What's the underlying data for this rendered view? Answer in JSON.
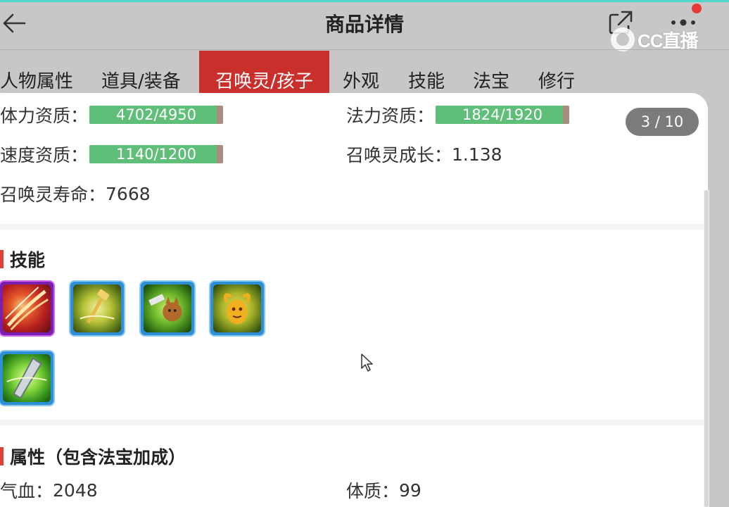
{
  "header": {
    "title": "商品详情"
  },
  "watermark": {
    "text": "CC直播"
  },
  "tabs": [
    {
      "label": "人物属性",
      "active": false
    },
    {
      "label": "道具/装备",
      "active": false
    },
    {
      "label": "召唤灵/孩子",
      "active": true
    },
    {
      "label": "外观",
      "active": false
    },
    {
      "label": "技能",
      "active": false
    },
    {
      "label": "法宝",
      "active": false
    },
    {
      "label": "修行",
      "active": false
    }
  ],
  "stats": {
    "hp_aptitude": {
      "label": "体力资质：",
      "value": "4702/4950",
      "fraction": 0.95
    },
    "mp_aptitude": {
      "label": "法力资质：",
      "value": "1824/1920",
      "fraction": 0.95
    },
    "speed_aptitude": {
      "label": "速度资质：",
      "value": "1140/1200",
      "fraction": 0.95
    },
    "growth": {
      "label": "召唤灵成长：",
      "value": "1.138"
    },
    "lifespan": {
      "label": "召唤灵寿命：",
      "value": "7668"
    }
  },
  "pager": {
    "text": "3 / 10"
  },
  "skills_section": {
    "title": "技能",
    "icons": [
      "skill-icon-fire-slash",
      "skill-icon-golden-hammer",
      "skill-icon-green-cat-warrior",
      "skill-icon-golden-demon",
      "skill-icon-green-blade"
    ]
  },
  "attributes_section": {
    "title": "属性（包含法宝加成）",
    "qixue": {
      "label": "气血：",
      "value": "2048"
    },
    "tizhi": {
      "label": "体质：",
      "value": "99"
    }
  },
  "colors": {
    "accent": "#c9302c",
    "bar_fill": "#5fbf78",
    "bar_bg": "#a78d7e",
    "section_mark": "#e0403a"
  }
}
